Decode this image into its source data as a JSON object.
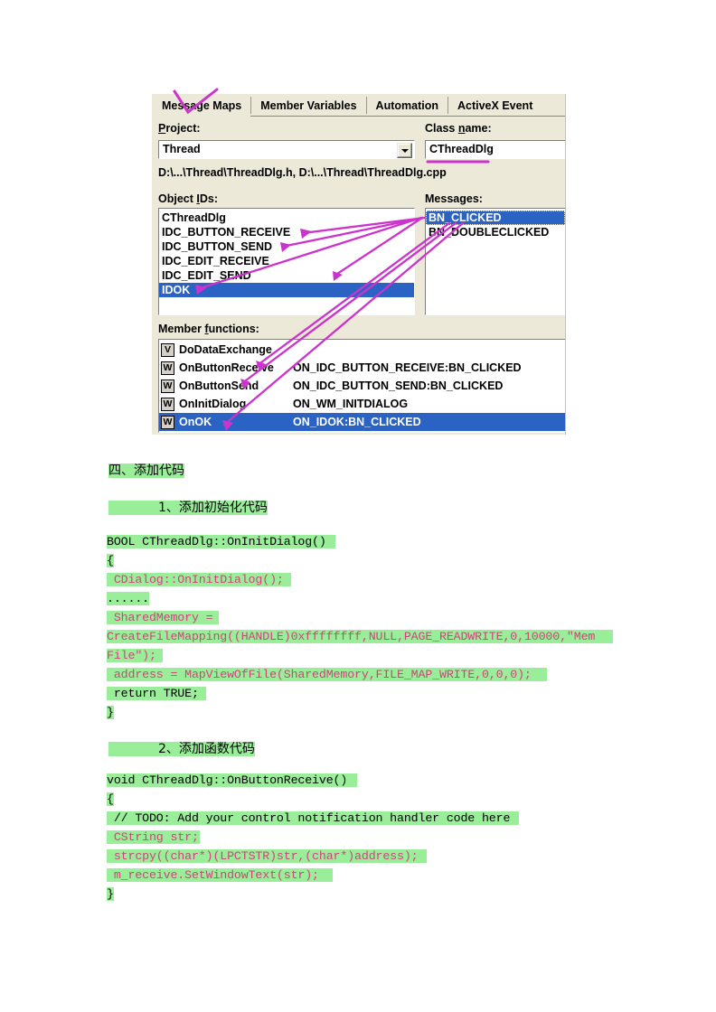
{
  "dialog": {
    "tabs": [
      {
        "label": "Message Maps",
        "active": true
      },
      {
        "label": "Member Variables",
        "active": false
      },
      {
        "label": "Automation",
        "active": false
      },
      {
        "label": "ActiveX Event",
        "active": false
      }
    ],
    "project_label": "Project:",
    "project_label_pre": "P",
    "project_label_post": "roject:",
    "project_value": "Thread",
    "class_name_label_pre": "Class ",
    "class_name_label_mid": "n",
    "class_name_label_post": "ame:",
    "class_name_value": "CThreadDlg",
    "file_path": "D:\\...\\Thread\\ThreadDlg.h, D:\\...\\Thread\\ThreadDlg.cpp",
    "object_ids_label_pre": "Object ",
    "object_ids_label_mid": "I",
    "object_ids_label_post": "Ds:",
    "messages_label_pre": "Messa",
    "messages_label_mid": "g",
    "messages_label_post": "es:",
    "object_ids": [
      {
        "label": "CThreadDlg",
        "selected": false
      },
      {
        "label": "IDC_BUTTON_RECEIVE",
        "selected": false
      },
      {
        "label": "IDC_BUTTON_SEND",
        "selected": false
      },
      {
        "label": "IDC_EDIT_RECEIVE",
        "selected": false
      },
      {
        "label": "IDC_EDIT_SEND",
        "selected": false
      },
      {
        "label": "IDOK",
        "selected": true
      }
    ],
    "messages": [
      {
        "label": "BN_CLICKED",
        "selected": true
      },
      {
        "label": "BN_DOUBLECLICKED",
        "selected": false
      }
    ],
    "member_functions_label_pre": "Member ",
    "member_functions_label_mid": "f",
    "member_functions_label_post": "unctions:",
    "member_functions": [
      {
        "icon": "V",
        "name": "DoDataExchange",
        "message": "",
        "selected": false
      },
      {
        "icon": "W",
        "name": "OnButtonReceive",
        "message": "ON_IDC_BUTTON_RECEIVE:BN_CLICKED",
        "selected": false
      },
      {
        "icon": "W",
        "name": "OnButtonSend",
        "message": "ON_IDC_BUTTON_SEND:BN_CLICKED",
        "selected": false
      },
      {
        "icon": "W",
        "name": "OnInitDialog",
        "message": "ON_WM_INITDIALOG",
        "selected": false
      },
      {
        "icon": "W",
        "name": "OnOK",
        "message": "ON_IDOK:BN_CLICKED",
        "selected": true
      }
    ]
  },
  "annotation": {
    "ink_color": "#cc33cc",
    "check_over_tab": "check-mark",
    "underline_class_name": "underline"
  },
  "document": {
    "heading_1": "四、添加代码",
    "heading_2": "1、添加初始化代码",
    "heading_3": "2、添加函数代码",
    "code_block_1": [
      {
        "text": "BOOL CThreadDlg::OnInitDialog()",
        "color": "black",
        "hl_width": 253
      },
      {
        "text": "{",
        "color": "black",
        "hl_width": 7
      },
      {
        "text": " CDialog::OnInitDialog();",
        "color": "pink",
        "hl_width": 204
      },
      {
        "text": "......",
        "color": "black",
        "hl_width": 46
      },
      {
        "text": " SharedMemory =",
        "color": "pink",
        "hl_width": 124
      },
      {
        "text": "CreateFileMapping((HANDLE)0xffffffff,NULL,PAGE_READWRITE,0,10000,\"Mem",
        "color": "pink",
        "hl_width": 560
      },
      {
        "text": "File\");",
        "color": "pink",
        "hl_width": 62
      },
      {
        "text": " address = MapViewOfFile(SharedMemory,FILE_MAP_WRITE,0,0,0);",
        "color": "pink",
        "hl_width": 487
      },
      {
        "text": " return TRUE;",
        "color": "black",
        "hl_width": 110
      },
      {
        "text": "}",
        "color": "black",
        "hl_width": 7
      }
    ],
    "code_block_2": [
      {
        "text": "void CThreadDlg::OnButtonReceive()",
        "color": "black",
        "hl_width": 277
      },
      {
        "text": "{",
        "color": "black",
        "hl_width": 7
      },
      {
        "text": " // TODO: Add your control notification handler code here",
        "color": "black",
        "hl_width": 456
      },
      {
        "text": " CString str;",
        "color": "pink",
        "hl_width": 103
      },
      {
        "text": " strcpy((char*)(LPCTSTR)str,(char*)address);",
        "color": "pink",
        "hl_width": 354
      },
      {
        "text": " m_receive.SetWindowText(str);",
        "color": "pink",
        "hl_width": 250
      },
      {
        "text": "}",
        "color": "black",
        "hl_width": 7
      }
    ]
  }
}
